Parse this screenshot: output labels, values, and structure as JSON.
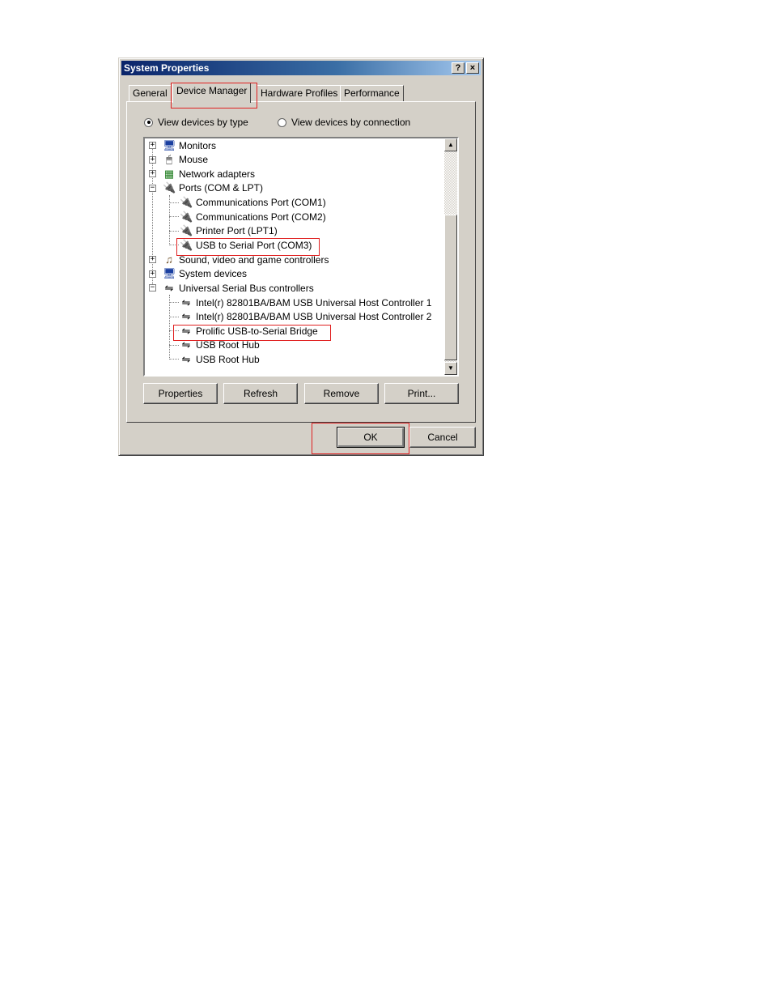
{
  "window": {
    "title": "System Properties",
    "help_label": "?",
    "close_label": "×"
  },
  "tabs": [
    {
      "label": "General"
    },
    {
      "label": "Device Manager"
    },
    {
      "label": "Hardware Profiles"
    },
    {
      "label": "Performance"
    }
  ],
  "view_options": {
    "by_type": "View devices by type",
    "by_connection": "View devices by connection",
    "selected": "by_type"
  },
  "tree": {
    "items": [
      {
        "label": "Monitors",
        "icon": "monitor-icon"
      },
      {
        "label": "Mouse",
        "icon": "mouse-icon"
      },
      {
        "label": "Network adapters",
        "icon": "network-icon"
      },
      {
        "label": "Ports (COM & LPT)",
        "icon": "port-icon"
      },
      {
        "label": "Communications Port (COM1)",
        "icon": "port-icon"
      },
      {
        "label": "Communications Port (COM2)",
        "icon": "port-icon"
      },
      {
        "label": "Printer Port (LPT1)",
        "icon": "port-icon"
      },
      {
        "label": "USB to Serial Port (COM3)",
        "icon": "port-icon"
      },
      {
        "label": "Sound, video and game controllers",
        "icon": "sound-icon"
      },
      {
        "label": "System devices",
        "icon": "computer-icon"
      },
      {
        "label": "Universal Serial Bus controllers",
        "icon": "usb-icon"
      },
      {
        "label": "Intel(r) 82801BA/BAM USB Universal Host Controller 1",
        "icon": "usb-icon"
      },
      {
        "label": "Intel(r) 82801BA/BAM USB Universal Host Controller 2",
        "icon": "usb-icon"
      },
      {
        "label": "Prolific USB-to-Serial Bridge",
        "icon": "usb-icon"
      },
      {
        "label": "USB Root Hub",
        "icon": "usb-icon"
      },
      {
        "label": "USB Root Hub",
        "icon": "usb-icon"
      }
    ]
  },
  "buttons": {
    "properties": "Properties",
    "refresh": "Refresh",
    "remove": "Remove",
    "print": "Print...",
    "ok": "OK",
    "cancel": "Cancel"
  },
  "colors": {
    "highlight": "#e02020",
    "titlebar": "#0a246a"
  }
}
